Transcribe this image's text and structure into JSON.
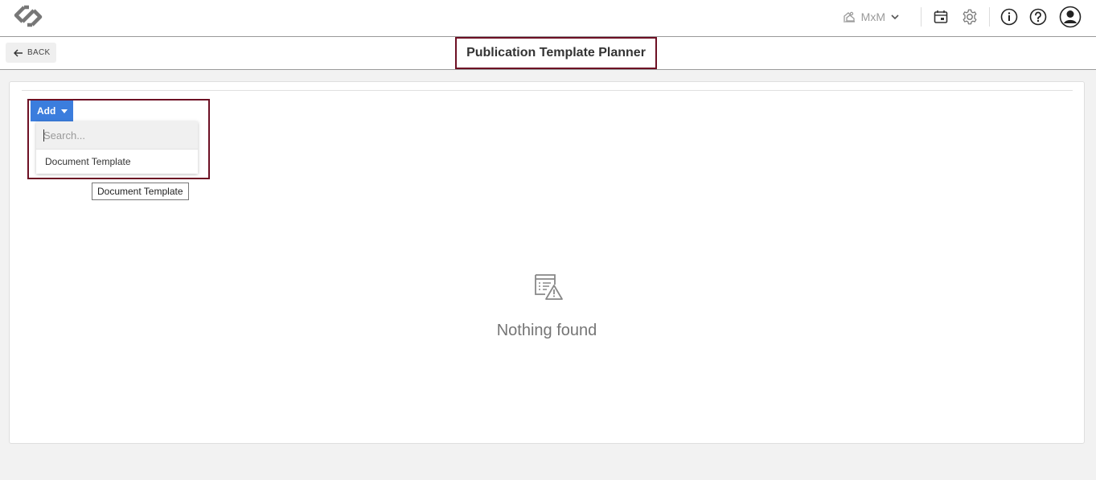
{
  "header": {
    "workspace_label": "MxM"
  },
  "subheader": {
    "back_label": "BACK",
    "title": "Publication Template Planner"
  },
  "toolbar": {
    "add_label": "Add"
  },
  "add_menu": {
    "search_placeholder": "Search...",
    "items": [
      {
        "label": "Document Template"
      }
    ]
  },
  "tooltip": {
    "text": "Document Template"
  },
  "empty_state": {
    "message": "Nothing found"
  },
  "colors": {
    "accent": "#3b7ddd",
    "highlight_border": "#6d1024",
    "background": "#f2f2f2"
  }
}
